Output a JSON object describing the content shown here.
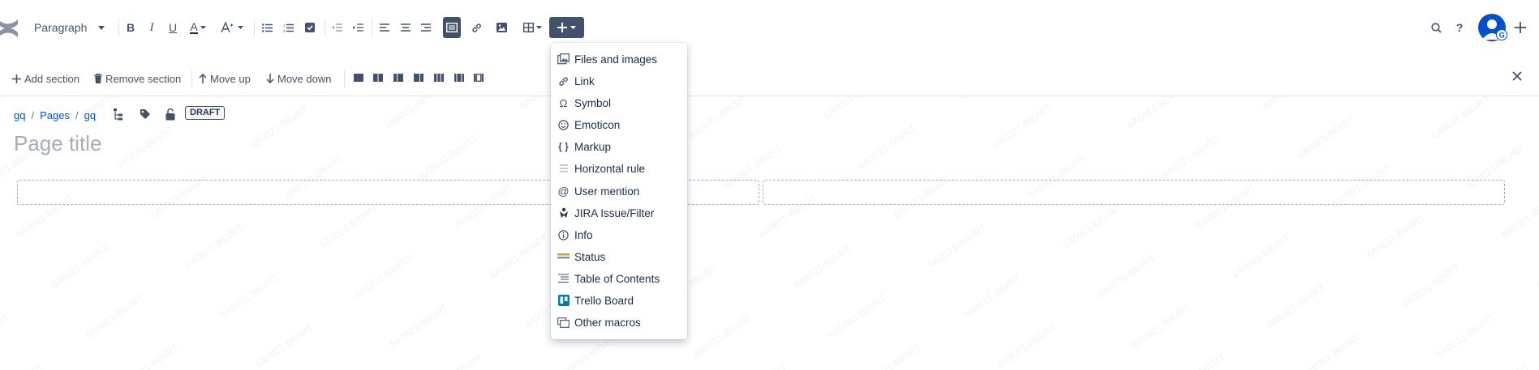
{
  "toolbar": {
    "paragraph_label": "Paragraph",
    "icons": [
      "bold-icon",
      "italic-icon",
      "underline-icon",
      "text-color-icon",
      "text-style-icon",
      "bullet-list-icon",
      "numbered-list-icon",
      "task-list-icon",
      "outdent-icon",
      "indent-icon",
      "align-left-icon",
      "align-center-icon",
      "align-right-icon",
      "page-layout-icon",
      "link-icon",
      "image-icon",
      "table-icon",
      "insert-icon",
      "search-icon",
      "help-icon",
      "avatar",
      "create-icon"
    ]
  },
  "sections": {
    "add_label": "Add section",
    "remove_label": "Remove section",
    "move_up_label": "Move up",
    "move_down_label": "Move down"
  },
  "breadcrumb": {
    "space": "gq",
    "pages": "Pages",
    "page": "gq",
    "draft_badge": "DRAFT"
  },
  "page": {
    "title_placeholder": "Page title"
  },
  "insert_menu": {
    "items": [
      {
        "label": "Files and images",
        "icon": "files-images-icon"
      },
      {
        "label": "Link",
        "icon": "link-icon"
      },
      {
        "label": "Symbol",
        "icon": "omega-icon"
      },
      {
        "label": "Emoticon",
        "icon": "emoticon-icon"
      },
      {
        "label": "Markup",
        "icon": "markup-icon"
      },
      {
        "label": "Horizontal rule",
        "icon": "horizontal-rule-icon"
      },
      {
        "label": "User mention",
        "icon": "at-icon"
      },
      {
        "label": "JIRA Issue/Filter",
        "icon": "jira-icon"
      },
      {
        "label": "Info",
        "icon": "info-icon"
      },
      {
        "label": "Status",
        "icon": "status-icon"
      },
      {
        "label": "Table of Contents",
        "icon": "toc-icon"
      },
      {
        "label": "Trello Board",
        "icon": "trello-icon"
      },
      {
        "label": "Other macros",
        "icon": "macros-icon"
      }
    ]
  },
  "colors": {
    "accent": "#0052cc",
    "toolbar_icon": "#42526e",
    "active_bg": "#42526e",
    "placeholder": "#a5adba"
  }
}
